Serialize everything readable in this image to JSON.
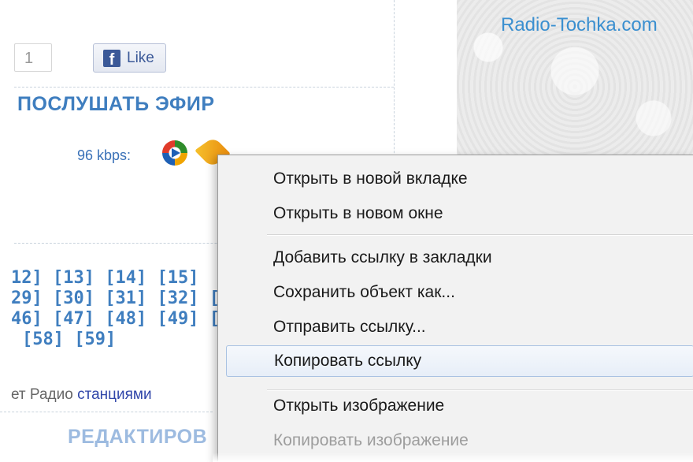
{
  "watermark": "Radio-Tochka.com",
  "like_widget": {
    "count": "1",
    "button_label": "Like",
    "fb_glyph": "f"
  },
  "listen": {
    "title": "ПОСЛУШАТЬ ЭФИР",
    "bitrate_label": "96 kbps:"
  },
  "pagination": [
    [
      "12]",
      "[13]",
      "[14]",
      "[15]"
    ],
    [
      "29]",
      "[30]",
      "[31]",
      "[32]",
      "["
    ],
    [
      "46]",
      "[47]",
      "[48]",
      "[49]",
      "["
    ],
    [
      "[58]",
      "[59]"
    ]
  ],
  "stations_text": {
    "prefix": "ет Радио ",
    "link": "станциями"
  },
  "edit_title": "РЕДАКТИРОВ",
  "context_menu": {
    "items": [
      {
        "label": "Открыть в новой вкладке",
        "state": "normal"
      },
      {
        "label": "Открыть в новом окне",
        "state": "normal"
      },
      {
        "label": "Добавить ссылку в закладки",
        "state": "normal"
      },
      {
        "label": "Сохранить объект как...",
        "state": "normal"
      },
      {
        "label": "Отправить ссылку...",
        "state": "normal"
      },
      {
        "label": "Копировать ссылку",
        "state": "hover"
      },
      {
        "label": "Открыть изображение",
        "state": "normal"
      },
      {
        "label": "Копировать изображение",
        "state": "disabled"
      }
    ]
  }
}
